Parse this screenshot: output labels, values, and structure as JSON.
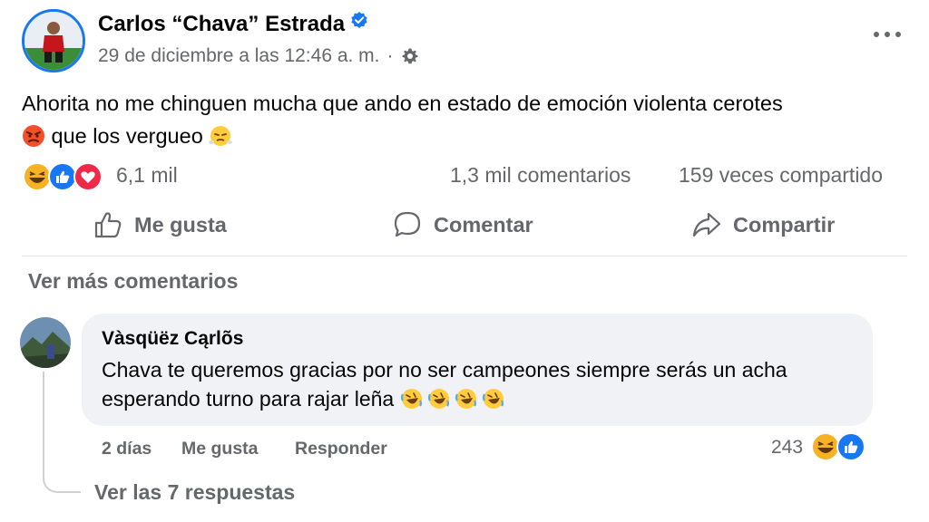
{
  "post": {
    "author": "Carlos “Chava” Estrada",
    "date": "29 de diciembre a las 12:46 a. m.",
    "separator": "·",
    "text_part1": "Ahorita no me chinguen mucha que ando en estado de emoción violenta cerotes ",
    "text_part2": " que los vergueo ",
    "reactions_count": "6,1 mil",
    "comments_count": "1,3 mil comentarios",
    "shares_count": "159 veces compartido"
  },
  "actions": {
    "like": "Me gusta",
    "comment": "Comentar",
    "share": "Compartir"
  },
  "comments_section": {
    "more_comments": "Ver más comentarios",
    "comment": {
      "author": "Vàsqüëz Cąrlõs",
      "text": "Chava te queremos gracias por no ser campeones siempre serás un acha esperando turno para rajar leña ",
      "time": "2 días",
      "like": "Me gusta",
      "reply": "Responder",
      "reactions_count": "243"
    },
    "view_replies": "Ver las 7 respuestas"
  },
  "colors": {
    "brand_blue": "#1877f2",
    "secondary_text": "#65676b",
    "love_red": "#f02849",
    "haha_yellow": "#f7b125",
    "bubble_bg": "#f0f2f5"
  },
  "icons": [
    "verified-badge-icon",
    "audience-gear-icon",
    "more-options-icon",
    "angry-emoji-icon",
    "huffing-emoji-icon",
    "haha-reaction-icon",
    "like-reaction-icon",
    "love-reaction-icon",
    "thumbs-up-icon",
    "comment-bubble-icon",
    "share-arrow-icon",
    "rofl-emoji-icon"
  ]
}
